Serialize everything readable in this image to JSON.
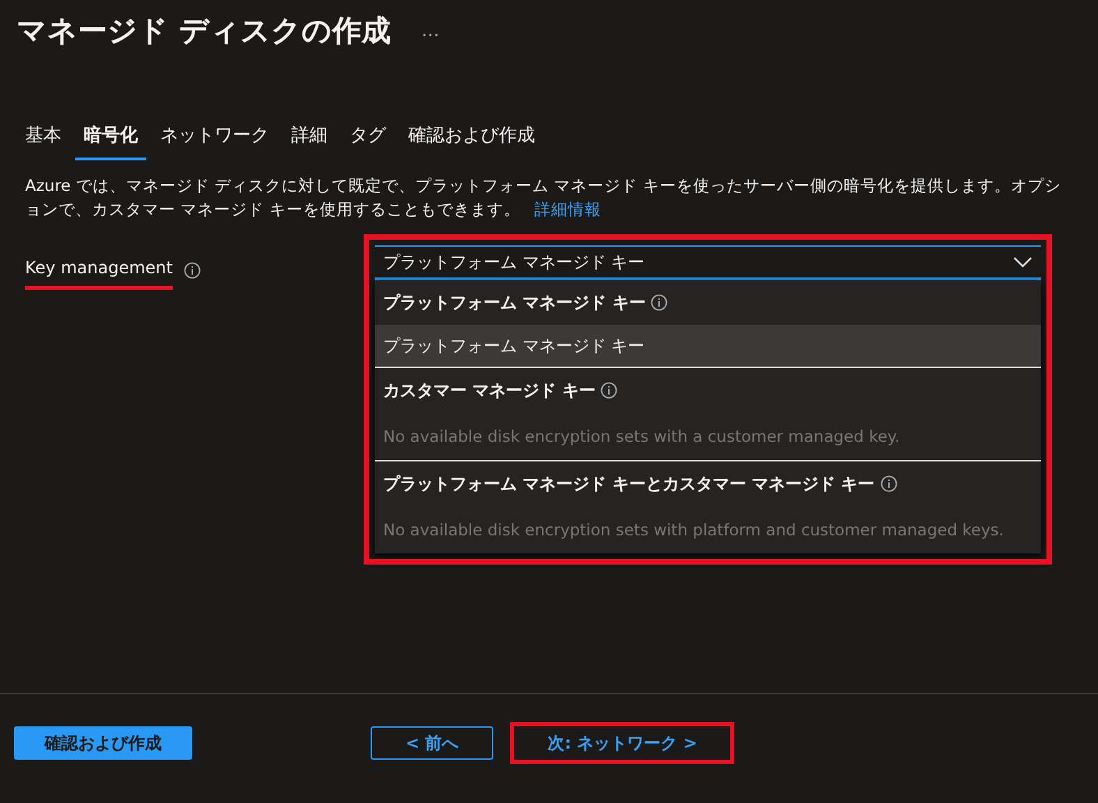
{
  "title": "マネージド ディスクの作成",
  "more": "…",
  "tabs": [
    {
      "label": "基本",
      "selected": false
    },
    {
      "label": "暗号化",
      "selected": true
    },
    {
      "label": "ネットワーク",
      "selected": false
    },
    {
      "label": "詳細",
      "selected": false
    },
    {
      "label": "タグ",
      "selected": false
    },
    {
      "label": "確認および作成",
      "selected": false
    }
  ],
  "description": "Azure では、マネージド ディスクに対して既定で、プラットフォーム マネージド キーを使ったサーバー側の暗号化を提供します。オプションで、カスタマー マネージド キーを使用することもできます。",
  "learn_more": "詳細情報",
  "key_management": {
    "label": "Key management",
    "highlighted": true,
    "value": "プラットフォーム マネージド キー",
    "expanded": true,
    "highlighted_dropdown": true,
    "groups": [
      {
        "header": "プラットフォーム マネージド キー",
        "options": [
          {
            "label": "プラットフォーム マネージド キー",
            "selected": true
          }
        ]
      },
      {
        "header": "カスタマー マネージド キー",
        "empty_message": "No available disk encryption sets with a customer managed key."
      },
      {
        "header": "プラットフォーム マネージド キーとカスタマー マネージド キー",
        "empty_message": "No available disk encryption sets with platform and customer managed keys."
      }
    ]
  },
  "buttons": [
    {
      "label": "確認および作成",
      "kind": "primary",
      "highlighted": false
    },
    {
      "label": "< 前へ",
      "kind": "outline",
      "highlighted": false
    },
    {
      "label": "次: ネットワーク >",
      "kind": "plain",
      "highlighted": true
    }
  ]
}
